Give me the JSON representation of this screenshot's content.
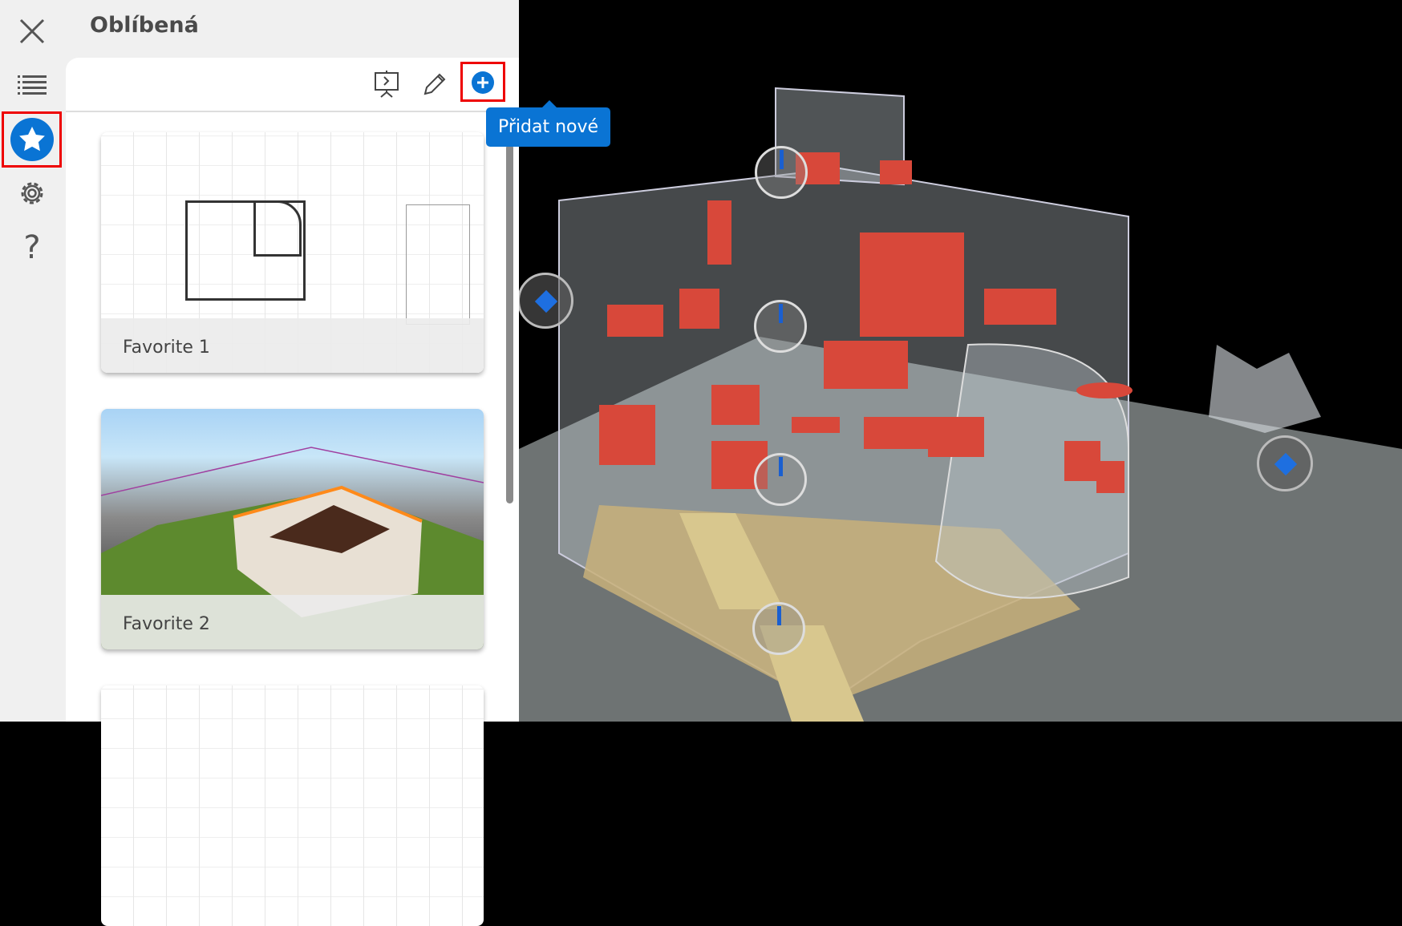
{
  "sidebar": {
    "items": [
      {
        "name": "close",
        "icon": "close-icon"
      },
      {
        "name": "list",
        "icon": "list-icon"
      },
      {
        "name": "favorites",
        "icon": "star-icon",
        "active": true
      },
      {
        "name": "settings",
        "icon": "gear-icon"
      },
      {
        "name": "help",
        "icon": "help-icon",
        "label": "?"
      }
    ]
  },
  "panel": {
    "title": "Oblíbená",
    "toolbar": {
      "present_icon": "presentation-icon",
      "edit_icon": "pencil-icon",
      "add_icon": "plus-circle-icon",
      "add_tooltip": "Přidat nové"
    },
    "favorites": [
      {
        "label": "Favorite 1"
      },
      {
        "label": "Favorite 2"
      },
      {
        "label": ""
      }
    ]
  },
  "colors": {
    "accent": "#0a74d4",
    "highlight": "#ee0000"
  }
}
